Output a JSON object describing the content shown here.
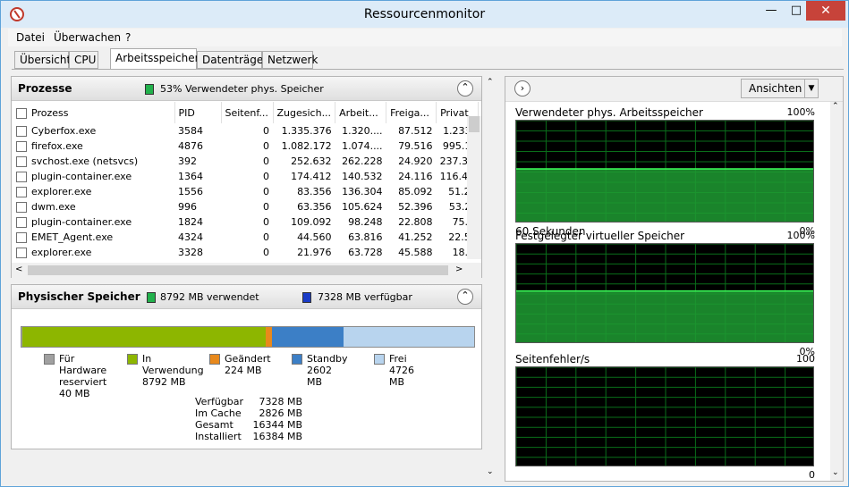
{
  "window": {
    "title": "Ressourcenmonitor",
    "min_icon": "minimize-icon",
    "max_icon": "maximize-icon",
    "close_icon": "close-icon"
  },
  "menu": [
    "Datei",
    "Überwachen",
    "?"
  ],
  "tabs": [
    "Übersicht",
    "CPU",
    "Arbeitsspeicher",
    "Datenträger",
    "Netzwerk"
  ],
  "processes": {
    "title": "Prozesse",
    "status": "53% Verwendeter phys. Speicher",
    "status_color": "#22b14c",
    "columns": [
      "Prozess",
      "PID",
      "Seitenf...",
      "Zugesich...",
      "Arbeit...",
      "Freiga...",
      "Privat"
    ],
    "rows": [
      [
        "Cyberfox.exe",
        "3584",
        "0",
        "1.335.376",
        "1.320....",
        "87.512",
        "1.233."
      ],
      [
        "firefox.exe",
        "4876",
        "0",
        "1.082.172",
        "1.074....",
        "79.516",
        "995.1:"
      ],
      [
        "svchost.exe (netsvcs)",
        "392",
        "0",
        "252.632",
        "262.228",
        "24.920",
        "237.30"
      ],
      [
        "plugin-container.exe",
        "1364",
        "0",
        "174.412",
        "140.532",
        "24.116",
        "116.41"
      ],
      [
        "explorer.exe",
        "1556",
        "0",
        "83.356",
        "136.304",
        "85.092",
        "51.2!"
      ],
      [
        "dwm.exe",
        "996",
        "0",
        "63.356",
        "105.624",
        "52.396",
        "53.2:"
      ],
      [
        "plugin-container.exe",
        "1824",
        "0",
        "109.092",
        "98.248",
        "22.808",
        "75.4"
      ],
      [
        "EMET_Agent.exe",
        "4324",
        "0",
        "44.560",
        "63.816",
        "41.252",
        "22.5("
      ],
      [
        "explorer.exe",
        "3328",
        "0",
        "21.976",
        "63.728",
        "45.588",
        "18.1"
      ]
    ]
  },
  "physical": {
    "title": "Physischer Speicher",
    "used_label": "8792 MB verwendet",
    "free_label": "7328 MB verfügbar",
    "bar": [
      {
        "name": "Für Hardware reserviert",
        "mb": 40,
        "color": "#a0a0a0"
      },
      {
        "name": "In Verwendung",
        "mb": 8792,
        "color": "#8db600"
      },
      {
        "name": "Geändert",
        "mb": 224,
        "color": "#e8891c"
      },
      {
        "name": "Standby",
        "mb": 2602,
        "color": "#3c7fc6"
      },
      {
        "name": "Frei",
        "mb": 4726,
        "color": "#b8d4ee"
      }
    ],
    "legend": [
      {
        "l1": "Für Hardware",
        "l2": "reserviert",
        "l3": "40 MB"
      },
      {
        "l1": "In",
        "l2": "Verwendung",
        "l3": "8792 MB"
      },
      {
        "l1": "Geändert",
        "l2": "224 MB",
        "l3": ""
      },
      {
        "l1": "Standby",
        "l2": "2602 MB",
        "l3": ""
      },
      {
        "l1": "Frei",
        "l2": "4726 MB",
        "l3": ""
      }
    ],
    "summary": [
      {
        "k": "Verfügbar",
        "v": "7328 MB"
      },
      {
        "k": "Im Cache",
        "v": "2826 MB"
      },
      {
        "k": "Gesamt",
        "v": "16344 MB"
      },
      {
        "k": "Installiert",
        "v": "16384 MB"
      }
    ]
  },
  "right": {
    "view_button": "Ansichten",
    "graphs": [
      {
        "label": "Verwendeter phys. Arbeitsspeicher",
        "max": "100%",
        "min": "0%",
        "footer": "60 Sekunden",
        "values": [
          53,
          53,
          53,
          53,
          53,
          53,
          53,
          53,
          53,
          53,
          53,
          53,
          53,
          53,
          53,
          53,
          53,
          53,
          53,
          53,
          53,
          53,
          53,
          53,
          53,
          53,
          53,
          53,
          53,
          53,
          53,
          53,
          53,
          53,
          53,
          53,
          53,
          53,
          53,
          53,
          53,
          53,
          53,
          53,
          53,
          53,
          53,
          53,
          53,
          53,
          53,
          53,
          53,
          53,
          53,
          53,
          53,
          53,
          53,
          53
        ]
      },
      {
        "label": "Festgelegter virtueller Speicher",
        "max": "100%",
        "min": "0%",
        "footer": "",
        "values": [
          53,
          53,
          53,
          53,
          53,
          53,
          53,
          53,
          53,
          53,
          53,
          53,
          53,
          53,
          53,
          53,
          53,
          53,
          53,
          53,
          53,
          53,
          53,
          53,
          53,
          53,
          53,
          53,
          53,
          53,
          53,
          53,
          53,
          53,
          53,
          53,
          53,
          53,
          53,
          53,
          53,
          53,
          53,
          53,
          53,
          53,
          53,
          53,
          53,
          53,
          53,
          53,
          53,
          53,
          53,
          53,
          53,
          53,
          53,
          53
        ]
      },
      {
        "label": "Seitenfehler/s",
        "max": "100",
        "min": "0",
        "footer": "",
        "values": [
          0,
          0,
          0,
          0,
          0,
          0,
          0,
          0,
          0,
          0,
          0,
          0,
          0,
          0,
          0,
          0,
          0,
          0,
          0,
          0,
          0,
          0,
          0,
          0,
          0,
          0,
          0,
          0,
          0,
          0,
          0,
          0,
          0,
          0,
          0,
          0,
          0,
          0,
          0,
          0,
          0,
          0,
          0,
          0,
          0,
          0,
          0,
          0,
          0,
          0,
          0,
          0,
          0,
          0,
          0,
          0,
          0,
          0,
          0,
          0
        ]
      }
    ]
  }
}
